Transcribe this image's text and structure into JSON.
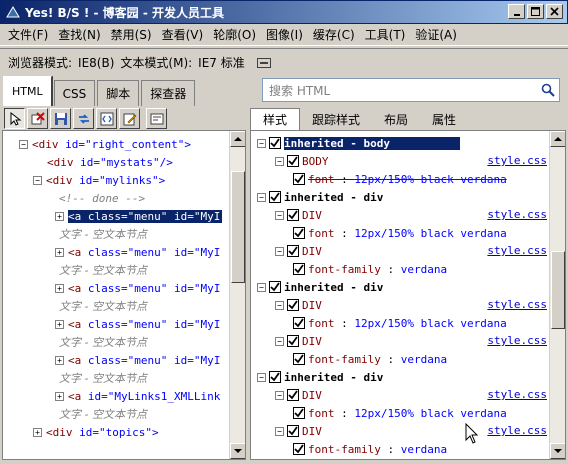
{
  "window": {
    "title": "Yes! B/S ! - 博客园 - 开发人员工具",
    "min": "0",
    "max": "1",
    "close": "r"
  },
  "menu": [
    "文件(F)",
    "查找(N)",
    "禁用(S)",
    "查看(V)",
    "轮廓(O)",
    "图像(I)",
    "缓存(C)",
    "工具(T)",
    "验证(A)"
  ],
  "mode": {
    "browser_label": "浏览器模式:",
    "browser_value": "IE8(B)",
    "doc_label": "文本模式(M):",
    "doc_value": "IE7 标准"
  },
  "tabs": [
    "HTML",
    "CSS",
    "脚本",
    "探查器"
  ],
  "search": {
    "placeholder": "搜索 HTML"
  },
  "subtabs": [
    "样式",
    "跟踪样式",
    "布局",
    "属性"
  ],
  "tree": [
    {
      "indent": 16,
      "plus": "minus",
      "tag": "<div",
      "attr": " id=\"right_content\">"
    },
    {
      "indent": 44,
      "plus": "",
      "tag": "<div",
      "attr": " id=\"mystats\"/>"
    },
    {
      "indent": 30,
      "plus": "minus",
      "tag": "<div",
      "attr": " id=\"mylinks\">"
    },
    {
      "indent": 56,
      "plus": "",
      "comment": "<!-- done -->"
    },
    {
      "indent": 52,
      "plus": "plus",
      "tag": "<a",
      "attr": " class=\"menu\" id=\"MyI",
      "selected": true
    },
    {
      "indent": 56,
      "plus": "",
      "text": "文字 - 空文本节点"
    },
    {
      "indent": 52,
      "plus": "plus",
      "tag": "<a",
      "attr": " class=\"menu\" id=\"MyI"
    },
    {
      "indent": 56,
      "plus": "",
      "text": "文字 - 空文本节点"
    },
    {
      "indent": 52,
      "plus": "plus",
      "tag": "<a",
      "attr": " class=\"menu\" id=\"MyI"
    },
    {
      "indent": 56,
      "plus": "",
      "text": "文字 - 空文本节点"
    },
    {
      "indent": 52,
      "plus": "plus",
      "tag": "<a",
      "attr": " class=\"menu\" id=\"MyI"
    },
    {
      "indent": 56,
      "plus": "",
      "text": "文字 - 空文本节点"
    },
    {
      "indent": 52,
      "plus": "plus",
      "tag": "<a",
      "attr": " class=\"menu\" id=\"MyI"
    },
    {
      "indent": 56,
      "plus": "",
      "text": "文字 - 空文本节点"
    },
    {
      "indent": 52,
      "plus": "plus",
      "tag": "<a",
      "attr": " id=\"MyLinks1_XMLLink"
    },
    {
      "indent": 56,
      "plus": "",
      "text": "文字 - 空文本节点"
    },
    {
      "indent": 30,
      "plus": "plus",
      "tag": "<div",
      "attr": " id=\"topics\">"
    }
  ],
  "styles": [
    {
      "kind": "head",
      "text": "inherited - body",
      "selected": true
    },
    {
      "kind": "rule",
      "selector": "BODY",
      "src": "style.css"
    },
    {
      "kind": "prop",
      "name": "font",
      "value": "12px/150% black verdana",
      "struck": true
    },
    {
      "kind": "head",
      "text": "inherited - div"
    },
    {
      "kind": "rule",
      "selector": "DIV",
      "src": "style.css"
    },
    {
      "kind": "prop",
      "name": "font",
      "value": "12px/150% black verdana"
    },
    {
      "kind": "rule",
      "selector": "DIV",
      "src": "style.css"
    },
    {
      "kind": "prop",
      "name": "font-family",
      "value": "verdana"
    },
    {
      "kind": "head",
      "text": "inherited - div"
    },
    {
      "kind": "rule",
      "selector": "DIV",
      "src": "style.css"
    },
    {
      "kind": "prop",
      "name": "font",
      "value": "12px/150% black verdana"
    },
    {
      "kind": "rule",
      "selector": "DIV",
      "src": "style.css"
    },
    {
      "kind": "prop",
      "name": "font-family",
      "value": "verdana"
    },
    {
      "kind": "head",
      "text": "inherited - div"
    },
    {
      "kind": "rule",
      "selector": "DIV",
      "src": "style.css"
    },
    {
      "kind": "prop",
      "name": "font",
      "value": "12px/150% black verdana"
    },
    {
      "kind": "rule",
      "selector": "DIV",
      "src": "style.css"
    },
    {
      "kind": "prop",
      "name": "font-family",
      "value": "verdana"
    }
  ]
}
